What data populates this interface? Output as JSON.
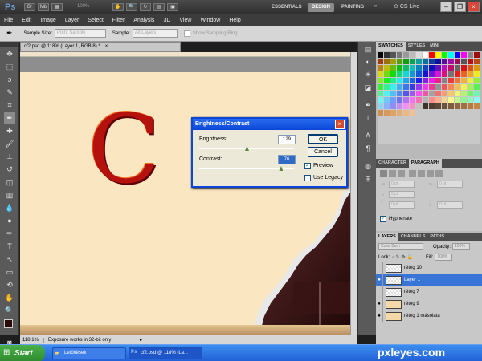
{
  "app": {
    "logo": "Ps",
    "zoom": "100%",
    "cs_live": "CS Live"
  },
  "workspaces": [
    "ESSENTIALS",
    "DESIGN",
    "PAINTING"
  ],
  "menu": [
    "File",
    "Edit",
    "Image",
    "Layer",
    "Select",
    "Filter",
    "Analysis",
    "3D",
    "View",
    "Window",
    "Help"
  ],
  "options": {
    "sample_size_label": "Sample Size:",
    "sample_size_value": "Point Sample",
    "sample_label": "Sample:",
    "sample_value": "All Layers",
    "ring_label": "Show Sampling Ring"
  },
  "document": {
    "tab": "cf2.psd @ 118% (Layer 1, RGB/8) *",
    "zoom": "118.1%",
    "status": "Exposure works in 32-bit only",
    "letter": "C"
  },
  "dialog": {
    "title": "Brightness/Contrast",
    "brightness_label": "Brightness:",
    "brightness_value": "129",
    "contrast_label": "Contrast:",
    "contrast_value": "76",
    "ok": "OK",
    "cancel": "Cancel",
    "preview": "Preview",
    "legacy": "Use Legacy",
    "brightness_level": 0.5,
    "contrast_level": 0.86
  },
  "panels": {
    "top_tabs": [
      "SWATCHES",
      "STYLES",
      "MINI"
    ],
    "char_tabs": [
      "CHARACTER",
      "PARAGRAPH"
    ],
    "char_fields": [
      "0 pt",
      "0 pt",
      "0 pt",
      "0 pt",
      "0 pt"
    ],
    "hyphenate": "Hyphenate",
    "layer_tabs": [
      "LAYERS",
      "CHANNELS",
      "PATHS"
    ],
    "blend": "Color Burn",
    "opacity_label": "Opacity:",
    "opacity": "100%",
    "lock_label": "Lock:",
    "fill_label": "Fill:",
    "fill": "100%",
    "layers": [
      {
        "name": "réteg 10",
        "selected": false,
        "visible": false
      },
      {
        "name": "Layer 1",
        "selected": true,
        "visible": true
      },
      {
        "name": "réteg 7",
        "selected": false,
        "visible": false
      },
      {
        "name": "réteg 9",
        "selected": false,
        "visible": true
      },
      {
        "name": "réteg 1 másolata",
        "selected": false,
        "visible": true
      }
    ]
  },
  "taskbar": {
    "start": "Start",
    "tasks": [
      "Letöltések",
      "cf2.psd @ 118% (La..."
    ],
    "watermark": "pxleyes.com"
  }
}
